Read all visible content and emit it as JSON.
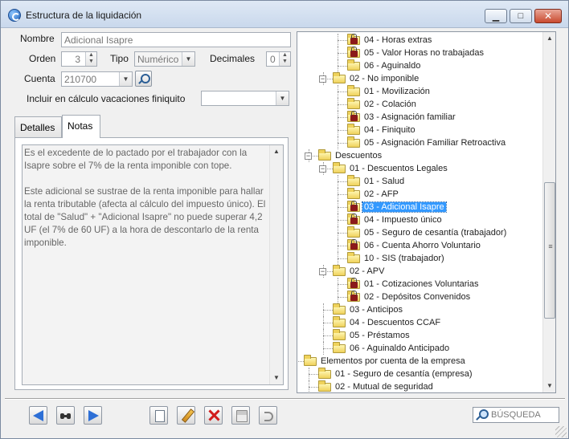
{
  "window": {
    "title": "Estructura de la liquidación",
    "controls": {
      "minimize": "▁",
      "maximize": "□",
      "close": "✕"
    }
  },
  "form": {
    "nombre": {
      "label": "Nombre",
      "value": "Adicional Isapre"
    },
    "orden": {
      "label": "Orden",
      "value": "3"
    },
    "tipo": {
      "label": "Tipo",
      "value": "Numérico"
    },
    "decimales": {
      "label": "Decimales",
      "value": "0"
    },
    "cuenta": {
      "label": "Cuenta",
      "value": "210700"
    },
    "vacaciones": {
      "label": "Incluir en cálculo vacaciones finiquito",
      "value": ""
    }
  },
  "tabs": [
    {
      "label": "Detalles",
      "active": false
    },
    {
      "label": "Notas",
      "active": true
    }
  ],
  "notes": {
    "text": "Es el excedente de lo pactado por el trabajador con la Isapre sobre el 7% de la renta imponible con tope.\n\nEste adicional se sustrae de la renta imponible para hallar la renta tributable (afecta al cálculo del impuesto único). El total de \"Salud\" + \"Adicional Isapre\" no puede superar 4,2 UF (el 7% de 60 UF) a la hora de descontarlo de la renta imponible."
  },
  "tree": {
    "rows": [
      {
        "label": "04 - Horas extras",
        "level": 4,
        "icon": "locked-folder"
      },
      {
        "label": "05 - Valor Horas no trabajadas",
        "level": 4,
        "icon": "locked-folder"
      },
      {
        "label": "06 - Aguinaldo",
        "level": 4,
        "icon": "folder"
      },
      {
        "label": "02 - No imponible",
        "level": 3,
        "icon": "folder",
        "expander": "−"
      },
      {
        "label": "01 - Movilización",
        "level": 4,
        "icon": "folder"
      },
      {
        "label": "02 - Colación",
        "level": 4,
        "icon": "folder"
      },
      {
        "label": "03 - Asignación familiar",
        "level": 4,
        "icon": "locked-folder"
      },
      {
        "label": "04 - Finiquito",
        "level": 4,
        "icon": "folder"
      },
      {
        "label": "05 - Asignación Familiar Retroactiva",
        "level": 4,
        "icon": "folder"
      },
      {
        "label": "Descuentos",
        "level": 2,
        "icon": "folder",
        "expander": "−"
      },
      {
        "label": "01 - Descuentos Legales",
        "level": 3,
        "icon": "folder",
        "expander": "−"
      },
      {
        "label": "01 - Salud",
        "level": 4,
        "icon": "folder"
      },
      {
        "label": "02 - AFP",
        "level": 4,
        "icon": "folder"
      },
      {
        "label": "03 - Adicional Isapre",
        "level": 4,
        "icon": "locked-folder",
        "selected": true
      },
      {
        "label": "04 - Impuesto único",
        "level": 4,
        "icon": "locked-folder"
      },
      {
        "label": "05 - Seguro de cesantía (trabajador)",
        "level": 4,
        "icon": "folder"
      },
      {
        "label": "06 - Cuenta Ahorro Voluntario",
        "level": 4,
        "icon": "locked-folder"
      },
      {
        "label": "10 - SIS (trabajador)",
        "level": 4,
        "icon": "folder"
      },
      {
        "label": "02 - APV",
        "level": 3,
        "icon": "folder",
        "expander": "−"
      },
      {
        "label": "01 - Cotizaciones Voluntarias",
        "level": 4,
        "icon": "locked-folder"
      },
      {
        "label": "02 - Depósitos Convenidos",
        "level": 4,
        "icon": "locked-folder"
      },
      {
        "label": "03 - Anticipos",
        "level": 3,
        "icon": "folder"
      },
      {
        "label": "04 - Descuentos CCAF",
        "level": 3,
        "icon": "folder"
      },
      {
        "label": "05 - Préstamos",
        "level": 3,
        "icon": "folder"
      },
      {
        "label": "06 - Aguinaldo Anticipado",
        "level": 3,
        "icon": "folder"
      },
      {
        "label": "Elementos por cuenta de la empresa",
        "level": 1,
        "icon": "folder",
        "expander": "−"
      },
      {
        "label": "01 - Seguro de cesantía (empresa)",
        "level": 2,
        "icon": "folder"
      },
      {
        "label": "02 - Mutual de seguridad",
        "level": 2,
        "icon": "folder"
      }
    ]
  },
  "toolbar": {
    "search_placeholder": "BÚSQUEDA"
  },
  "colors": {
    "selection": "#3399ff",
    "nav_arrow": "#2d6fd6",
    "delete": "#d11c1c",
    "folder": "#efd25b"
  }
}
